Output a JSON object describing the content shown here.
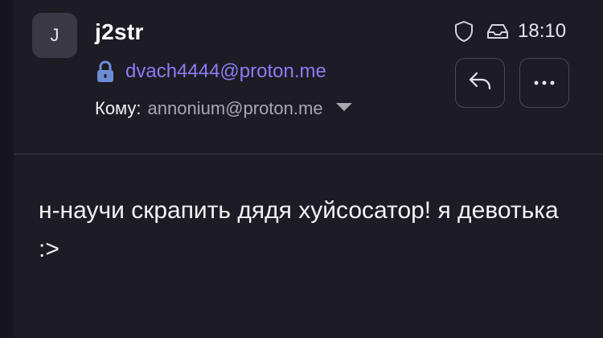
{
  "colors": {
    "background": "#16141c",
    "panel": "#1d1b24",
    "accent_email": "#8b7cf6",
    "lock_icon": "#6c8dd6"
  },
  "avatar": {
    "initial": "J"
  },
  "sender": {
    "name": "j2str"
  },
  "header": {
    "time": "18:10",
    "icons": [
      "shield-icon",
      "inbox-icon"
    ]
  },
  "from": {
    "address": "dvach4444@proton.me",
    "icon": "lock-icon"
  },
  "to": {
    "label": "Кому:",
    "address": "annonium@proton.me",
    "icon": "chevron-down-icon"
  },
  "actions": [
    {
      "name": "reply",
      "icon": "reply-icon"
    },
    {
      "name": "more",
      "icon": "more-horizontal-icon"
    }
  ],
  "message": {
    "body": "н-научи скрапить дядя хуйсосатор! я девотька :>"
  }
}
